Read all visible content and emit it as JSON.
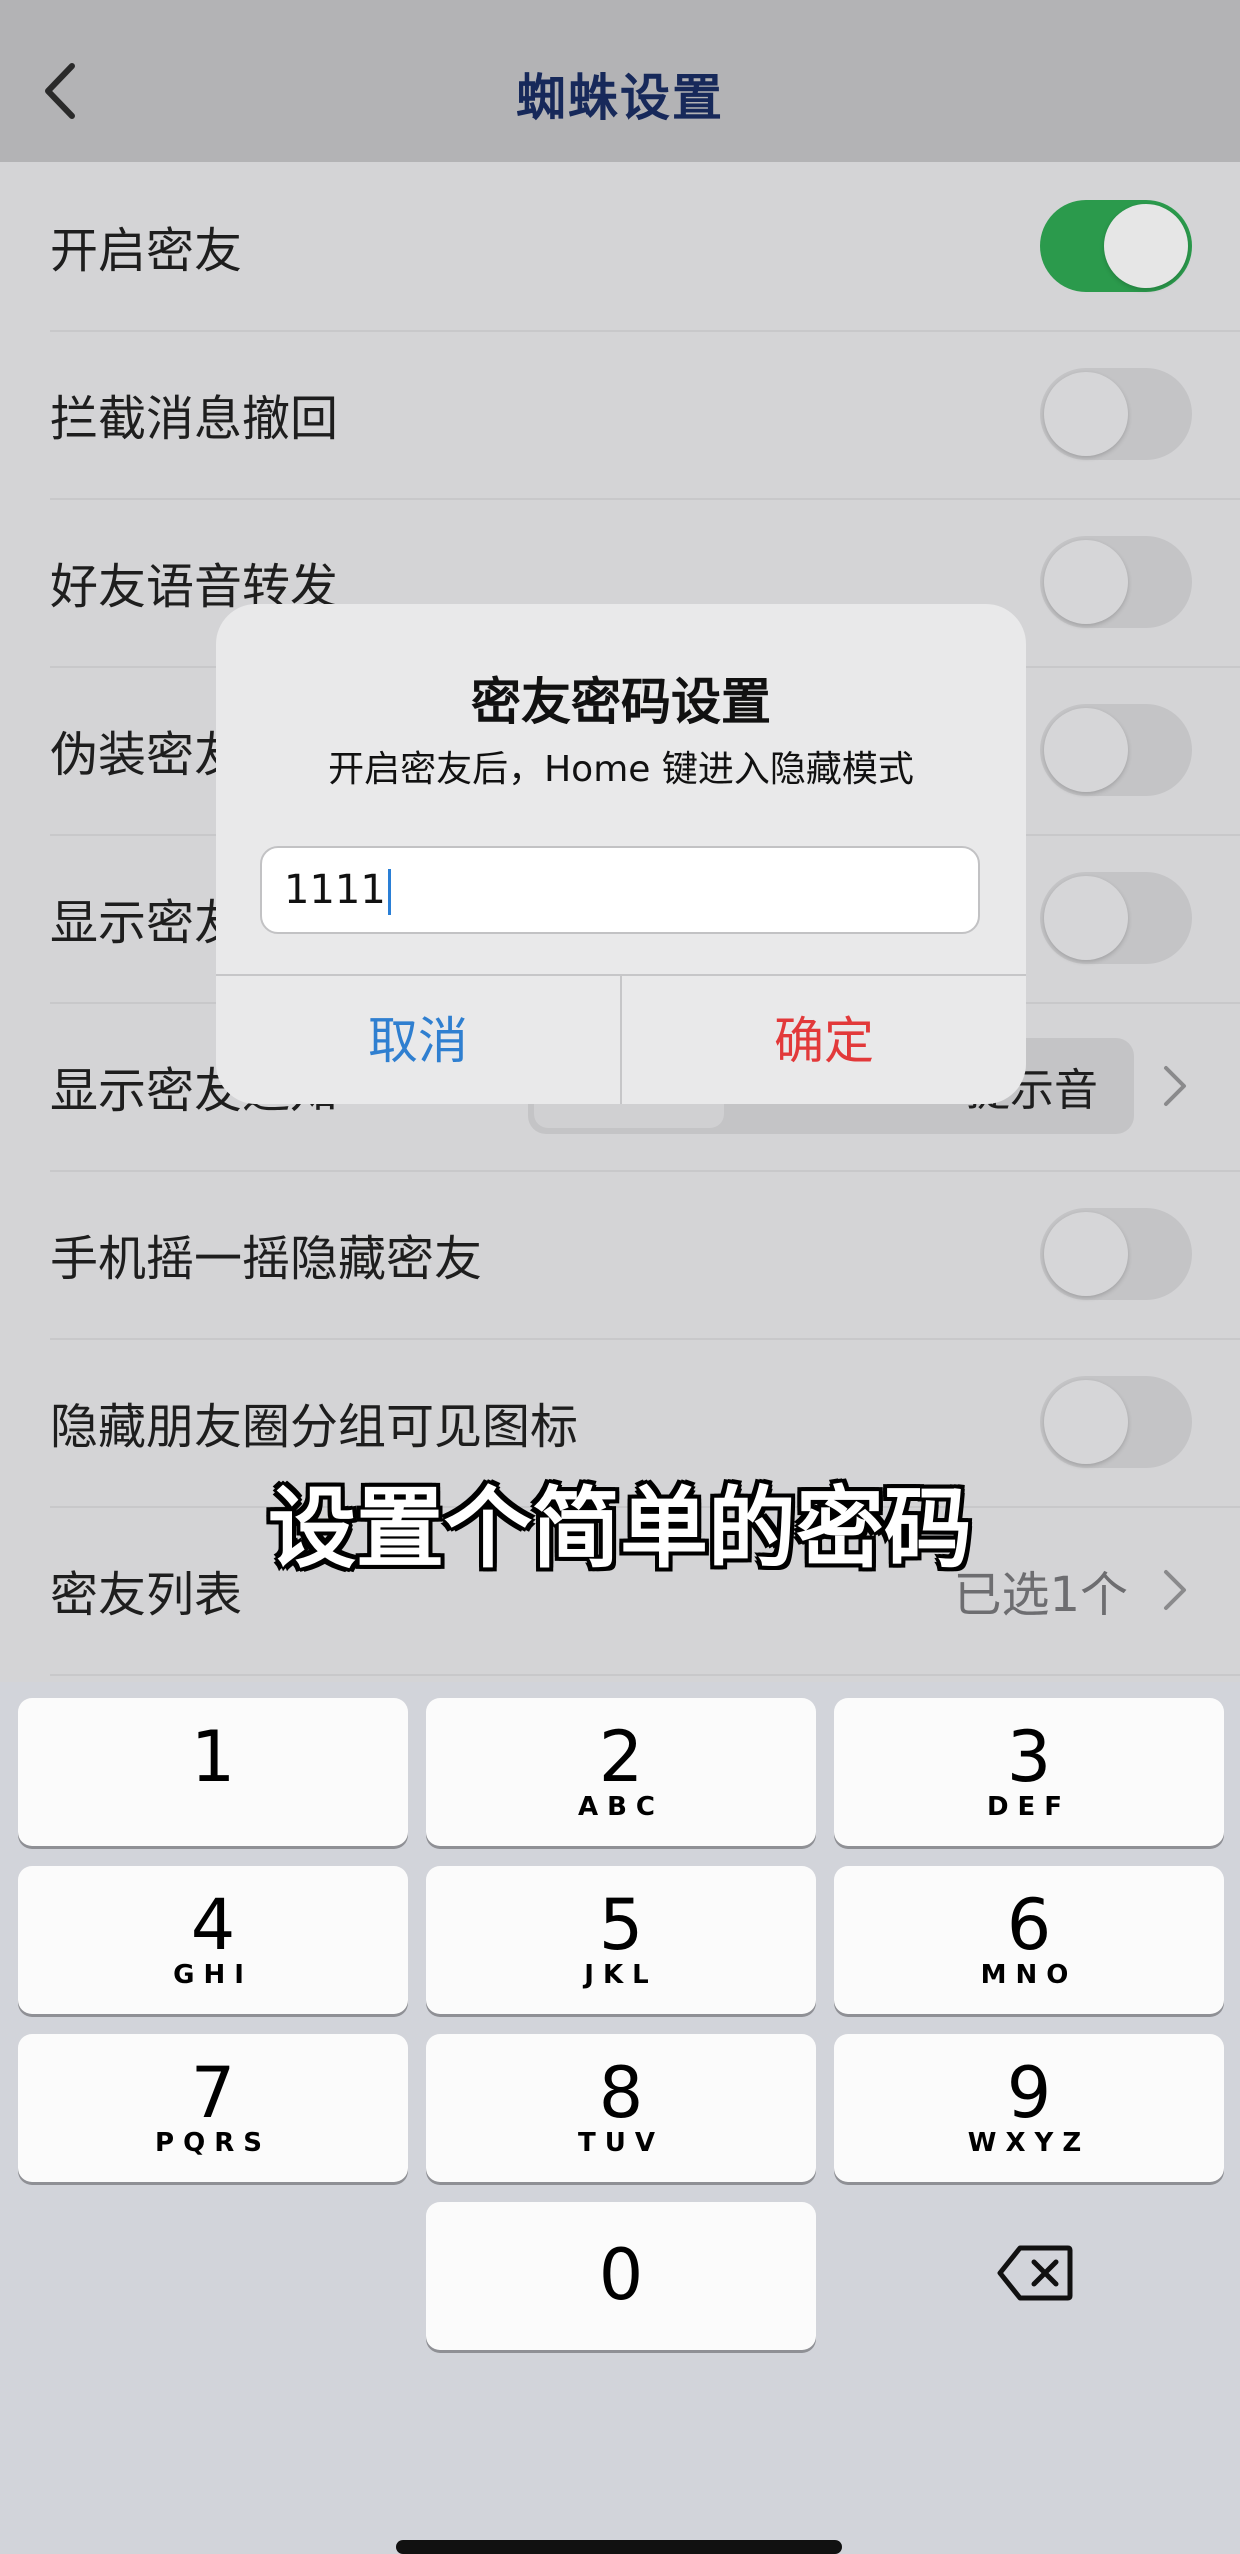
{
  "header": {
    "title": "蜘蛛设置",
    "back_icon": "chevron-left-icon"
  },
  "settings": {
    "rows": [
      {
        "label": "开启密友",
        "toggle": true
      },
      {
        "label": "拦截消息撤回",
        "toggle": false
      },
      {
        "label": "好友语音转发",
        "toggle": false
      },
      {
        "label": "伪装密友",
        "toggle": false
      },
      {
        "label": "显示密友",
        "toggle": false
      },
      {
        "label": "显示密友通知",
        "segment_text": "提示音"
      },
      {
        "label": "手机摇一摇隐藏密友",
        "toggle": false
      },
      {
        "label": "隐藏朋友圈分组可见图标",
        "toggle": false
      },
      {
        "label": "密友列表",
        "value": "已选1个"
      }
    ]
  },
  "caption": "设置个简单的密码",
  "dialog": {
    "title": "密友密码设置",
    "message": "开启密友后，Home 键进入隐藏模式",
    "input_value": "1111",
    "cancel_label": "取消",
    "ok_label": "确定"
  },
  "keypad": {
    "keys": [
      {
        "num": "1",
        "letters": ""
      },
      {
        "num": "2",
        "letters": "ABC"
      },
      {
        "num": "3",
        "letters": "DEF"
      },
      {
        "num": "4",
        "letters": "GHI"
      },
      {
        "num": "5",
        "letters": "JKL"
      },
      {
        "num": "6",
        "letters": "MNO"
      },
      {
        "num": "7",
        "letters": "PQRS"
      },
      {
        "num": "8",
        "letters": "TUV"
      },
      {
        "num": "9",
        "letters": "WXYZ"
      },
      {
        "num": "0",
        "letters": ""
      }
    ],
    "delete_icon": "backspace-icon"
  },
  "colors": {
    "toggle_on": "#2b9a4c",
    "title": "#17295a",
    "cancel": "#2f7fd0",
    "confirm": "#e2393a"
  }
}
